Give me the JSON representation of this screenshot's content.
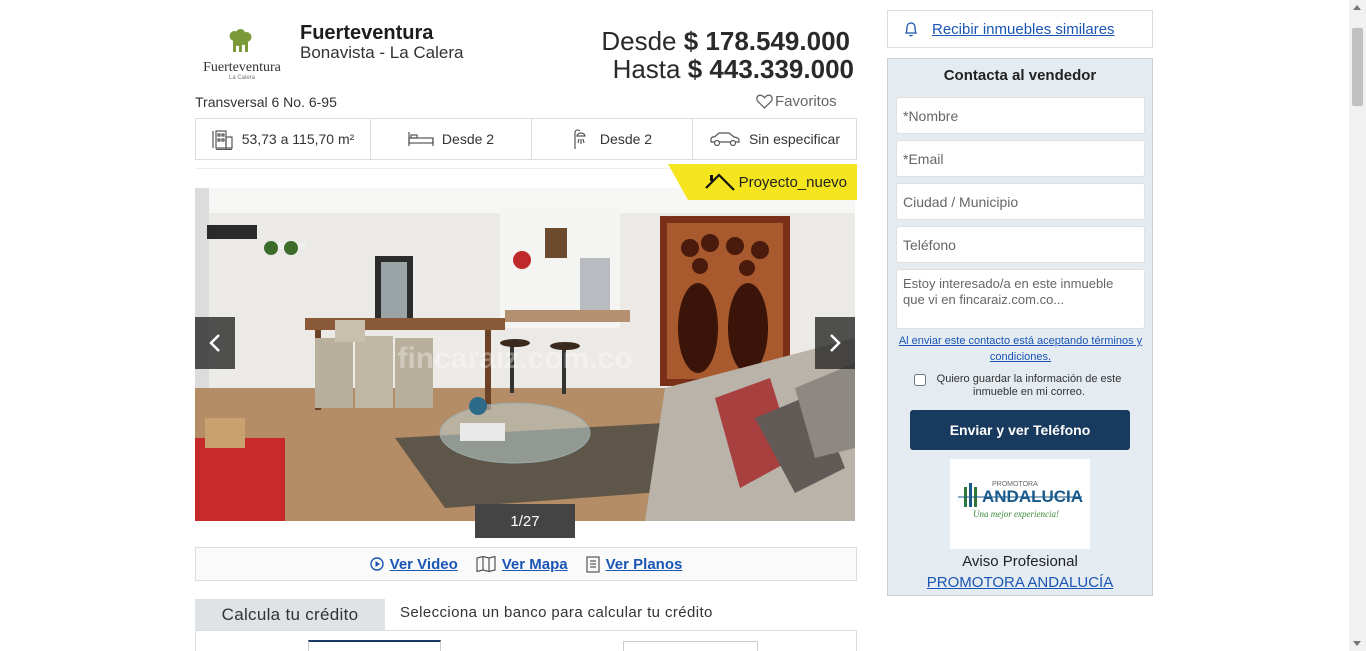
{
  "header": {
    "project_name": "Fuerteventura",
    "location": "Bonavista - La Calera",
    "price_from_label": "Desde",
    "price_from_value": "$ 178.549.000",
    "price_to_label": "Hasta",
    "price_to_value": "$ 443.339.000",
    "address": "Transversal 6 No. 6-95",
    "favorites_label": "Favoritos",
    "logo_text": "Fuerteventura",
    "logo_subtext": "La Calera"
  },
  "features": [
    {
      "icon": "building-area-icon",
      "label": "53,73 a 115,70 m²"
    },
    {
      "icon": "bed-icon",
      "label": "Desde  2"
    },
    {
      "icon": "shower-icon",
      "label": "Desde  2"
    },
    {
      "icon": "car-icon",
      "label": "Sin especificar"
    }
  ],
  "badge": {
    "label": "Proyecto_nuevo"
  },
  "gallery": {
    "counter": "1/27",
    "watermark": "fincaraiz.com.co"
  },
  "media_links": [
    {
      "icon": "play-icon",
      "label": "Ver Video"
    },
    {
      "icon": "map-icon",
      "label": "Ver Mapa"
    },
    {
      "icon": "plans-icon",
      "label": "Ver Planos"
    }
  ],
  "credit": {
    "tab_label": "Calcula tu crédito",
    "prompt": "Selecciona un banco para calcular tu crédito"
  },
  "alert": {
    "label": "Recibir inmuebles similares"
  },
  "contact": {
    "title": "Contacta al vendedor",
    "name_placeholder": "*Nombre",
    "email_placeholder": "*Email",
    "city_placeholder": "Ciudad / Municipio",
    "phone_placeholder": "Teléfono",
    "message_placeholder": "Estoy interesado/a en este inmueble que vi en fincaraiz.com.co...",
    "terms_text": "Al enviar este contacto está aceptando términos y condiciones.",
    "save_info_text": "Quiero guardar la información de este inmueble en mi correo.",
    "submit_label": "Enviar y ver Teléfono",
    "agent_type": "Aviso Profesional",
    "agent_name": "PROMOTORA ANDALUCÍA",
    "agent_logo_top": "PROMOTORA",
    "agent_logo_main": "ANDALUCIA",
    "agent_logo_tagline": "Una mejor experiencia!"
  },
  "colors": {
    "link": "#1a55b5",
    "badge": "#f4e51e",
    "submit": "#173a5e",
    "contact_bg": "#e4ebf1"
  }
}
